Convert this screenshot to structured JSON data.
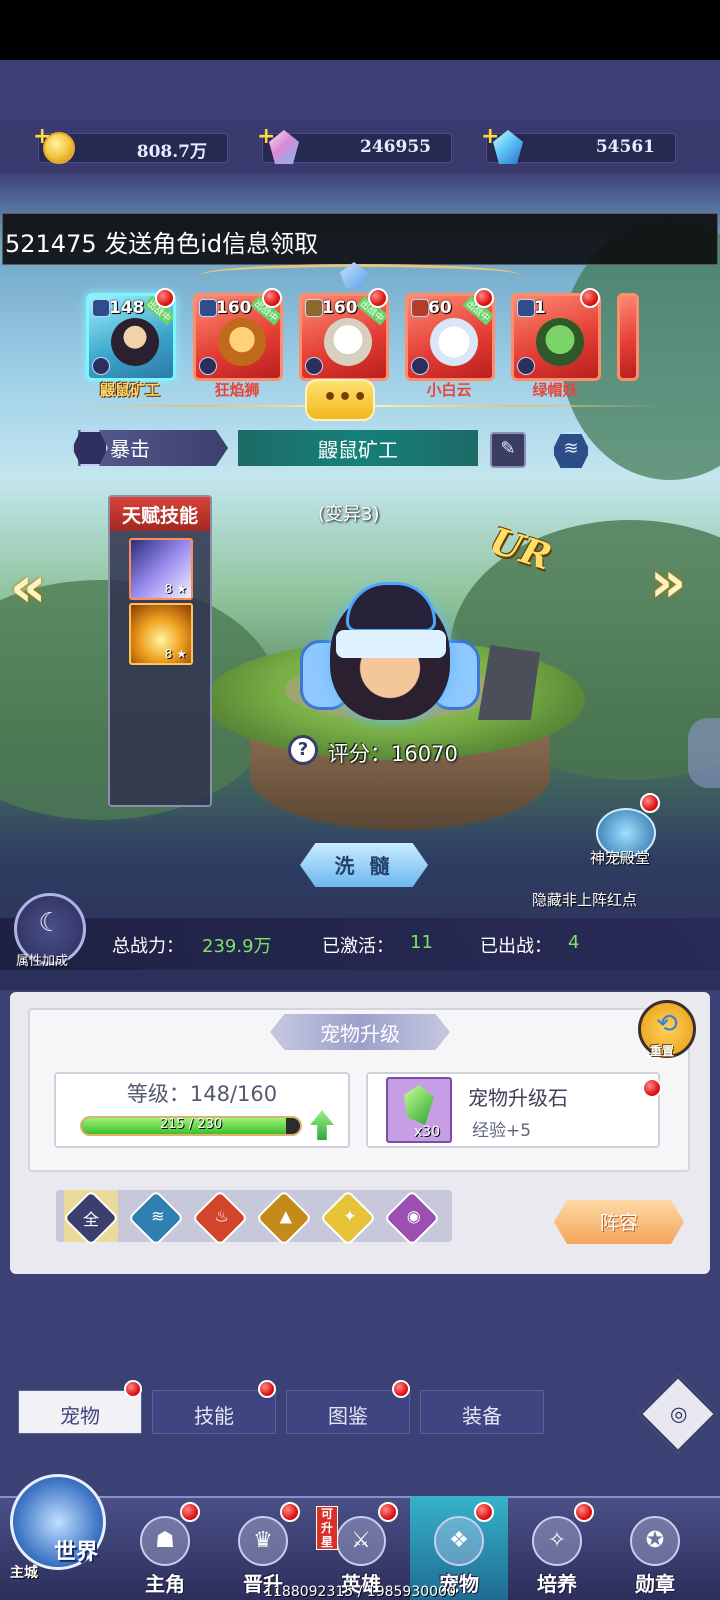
{
  "resources": {
    "gold": "808.7万",
    "crystal": "246955",
    "diamond": "54561"
  },
  "banner_text": "521475 发送角色id信息领取",
  "pets": [
    {
      "level": "148",
      "name": "鼹鼠矿工",
      "deployed": "出战中"
    },
    {
      "level": "160",
      "name": "狂焰狮",
      "deployed": "出战中"
    },
    {
      "level": "160",
      "name": "",
      "deployed": "出战中"
    },
    {
      "level": "60",
      "name": "小白云",
      "deployed": "出战中"
    },
    {
      "level": "1",
      "name": "绿帽妖",
      "deployed": ""
    }
  ],
  "chat_dots": "•••",
  "trait": "暴击",
  "current_pet_name": "鼹鼠矿工",
  "talent": {
    "title": "天赋技能",
    "skills": [
      {
        "level": "8 ★"
      },
      {
        "level": "8 ★"
      }
    ]
  },
  "mutation": "(变异3)",
  "rarity": "UR",
  "score_label": "评分：16070",
  "wash_button": "洗 髓",
  "pet_hall": "神宠殿堂",
  "hide_note": "隐藏非上阵红点",
  "attr_bonus": "属性加成",
  "stats": {
    "power_label": "总战力：",
    "power_value": "239.9万",
    "active_label": "已激活：",
    "active_value": "11",
    "deployed_label": "已出战：",
    "deployed_value": "4"
  },
  "upgrade": {
    "title": "宠物升级",
    "reset": "重置",
    "level_text": "等级：148/160",
    "exp_text": "215 / 230",
    "exp_fraction": 0.935,
    "stone_name": "宠物升级石",
    "stone_exp": "经验+5",
    "stone_count": "x30"
  },
  "filters": [
    "全",
    "水",
    "火",
    "土",
    "光",
    "暗"
  ],
  "lineup_button": "阵容",
  "subtabs": [
    "宠物",
    "技能",
    "图鉴",
    "装备"
  ],
  "nav": {
    "world": "世界",
    "city": "主城",
    "items": [
      "主角",
      "晋升",
      "英雄",
      "宠物",
      "培养",
      "勋章"
    ],
    "upgradable": "可升星"
  },
  "footer_id": "1188092315 / 1985930000",
  "colors": {
    "accent_green": "#7fe06a",
    "reddot": "#e01616",
    "nav_active": "#36b3c9"
  }
}
